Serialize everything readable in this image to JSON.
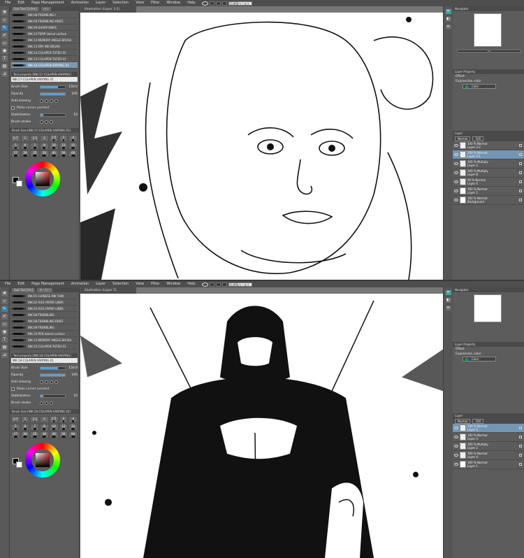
{
  "menu": [
    "File",
    "Edit",
    "Page Management",
    "Animation",
    "Layer",
    "Selection",
    "View",
    "Filter",
    "Window",
    "Help"
  ],
  "command_bar_chip": "CLIP用ベースページ",
  "top": {
    "subtool_tabs": [
      "Sub Tool [G-Pen]",
      "ペン"
    ],
    "brushes": [
      "INK:08-TREMBLING I",
      "INK:09-TREMBLING KNIFE",
      "INK:09-SHARP KNIFE",
      "INK:10-TEMP lateral surface",
      "INK:12-MEMORY ANGLE BRUSH",
      "INK:13-DRY INK BRUSH",
      "INK:14-COLAPEN TILTED 02",
      "INK:15-COLAPEN TILTED 01",
      "INK:16-COLAPEN VARYING 01"
    ],
    "selected_brush_index": 8,
    "tool_property_header": "Tool property [INK:17-COLAPEN VARYING]",
    "tool_name": "INK:17-COLAPEN VARYING 01",
    "props": {
      "brush_size_label": "Brush Size",
      "brush_size": "150.0",
      "brush_size_fill": 0.7,
      "opacity_label": "Opacity",
      "opacity": "100",
      "opacity_fill": 1.0,
      "antialias_label": "Anti-aliasing",
      "corner_label": "Make corner pointed",
      "stabilization_label": "Stabilization",
      "stabilization": "10",
      "stabilization_fill": 0.1,
      "brush_stroke_label": "Brush stroke"
    },
    "size_header": "Brush Size [INK:17-COLAPEN VARYING 01]",
    "sizes": [
      "0.7",
      "1",
      "1.5",
      "2",
      "2.5",
      "3",
      "4",
      "5",
      "6",
      "7",
      "8",
      "10",
      "12",
      "15",
      "17",
      "20",
      "25",
      "30",
      "40",
      "50",
      "60"
    ],
    "canvas_tab": "Illustration (Layer 3-1)",
    "right": {
      "navigator_label": "Navigator",
      "layer_property_label": "Layer Property",
      "effect_label": "Effect",
      "expression_color_label": "Expression color",
      "expression_color_value": "Color",
      "layer_tab": "Layer",
      "blend_mode": "Normal",
      "layer_opacity": "100",
      "layers": [
        {
          "mode": "100 % Normal",
          "name": "Layer 3-2",
          "thumb": "checker",
          "selected": false
        },
        {
          "mode": "100 % Normal",
          "name": "Layer 3-1",
          "thumb": "checker",
          "selected": true
        },
        {
          "mode": "100 % Multiply",
          "name": "Layer 2",
          "thumb": "checker",
          "selected": false
        },
        {
          "mode": "100 % Multiply",
          "name": "Layer 8",
          "thumb": "checker",
          "selected": false
        },
        {
          "mode": "50 % Normal",
          "name": "Layer 4",
          "thumb": "checker",
          "selected": false
        },
        {
          "mode": "100 % Normal",
          "name": "Layer 1",
          "thumb": "white",
          "selected": false
        },
        {
          "mode": "100 % Normal",
          "name": "Background",
          "thumb": "white",
          "selected": false
        }
      ]
    }
  },
  "bottom": {
    "subtool_tabs": [
      "Sub Tool [Ink]",
      "マーカー"
    ],
    "brushes": [
      "INK:01-CHINESE INK THIN",
      "INK:02-RICE PAPER LINER",
      "INK:03-RICE PAPER LINER",
      "INK:06-TREMBLING",
      "INK:08-TREMBLING KNIFE",
      "INK:09-TREMBLING",
      "INK:10-PEN lateral surface",
      "INK:12-MEMORY ANGLE BRUSH",
      "INK:15-COLAPEN TILTED 01"
    ],
    "selected_brush_index": -1,
    "tool_property_header": "Tool property [INK:18-COLAPEN VARYING]",
    "tool_name": "INK:18-COLAPEN VARYING 01",
    "props": {
      "brush_size_label": "Brush Size",
      "brush_size": "150.0",
      "brush_size_fill": 0.7,
      "opacity_label": "Opacity",
      "opacity": "100",
      "opacity_fill": 1.0,
      "antialias_label": "Anti-aliasing",
      "corner_label": "Make corner pointed",
      "stabilization_label": "Stabilization",
      "stabilization": "10",
      "stabilization_fill": 0.1,
      "brush_stroke_label": "Brush stroke"
    },
    "size_header": "Brush Size [INK:18-COLAPEN VARYING 02]",
    "sizes": [
      "0.7",
      "1",
      "1.5",
      "2",
      "2.5",
      "3",
      "4",
      "5",
      "6",
      "7",
      "8",
      "10",
      "12",
      "15",
      "17",
      "20",
      "25",
      "30",
      "40",
      "50",
      "60"
    ],
    "canvas_tab": "Illustration (Layer 5)",
    "right": {
      "navigator_label": "Navigator",
      "layer_property_label": "Layer Property",
      "effect_label": "Effect",
      "expression_color_label": "Expression color",
      "expression_color_value": "Color",
      "layer_tab": "Layer",
      "blend_mode": "Normal",
      "layer_opacity": "100",
      "layers": [
        {
          "mode": "100 % Normal",
          "name": "Layer 5",
          "thumb": "checker",
          "selected": true
        },
        {
          "mode": "100 % Normal",
          "name": "Layer 3",
          "thumb": "checker",
          "selected": false
        },
        {
          "mode": "100 % Multiply",
          "name": "Layer 2",
          "thumb": "checker",
          "selected": false
        },
        {
          "mode": "100 % Normal",
          "name": "Layer 4",
          "thumb": "checker",
          "selected": false
        },
        {
          "mode": "100 % Normal",
          "name": "Layer 1",
          "thumb": "white",
          "selected": false
        }
      ]
    }
  },
  "colors": {
    "accent": "#3d7fb0",
    "selection": "#7396b4",
    "ui_bg": "#5c5c5c"
  },
  "icons": [
    "move-icon",
    "zoom-icon",
    "pen-icon",
    "brush-icon",
    "eraser-icon",
    "fill-icon",
    "text-icon",
    "eye-icon"
  ]
}
